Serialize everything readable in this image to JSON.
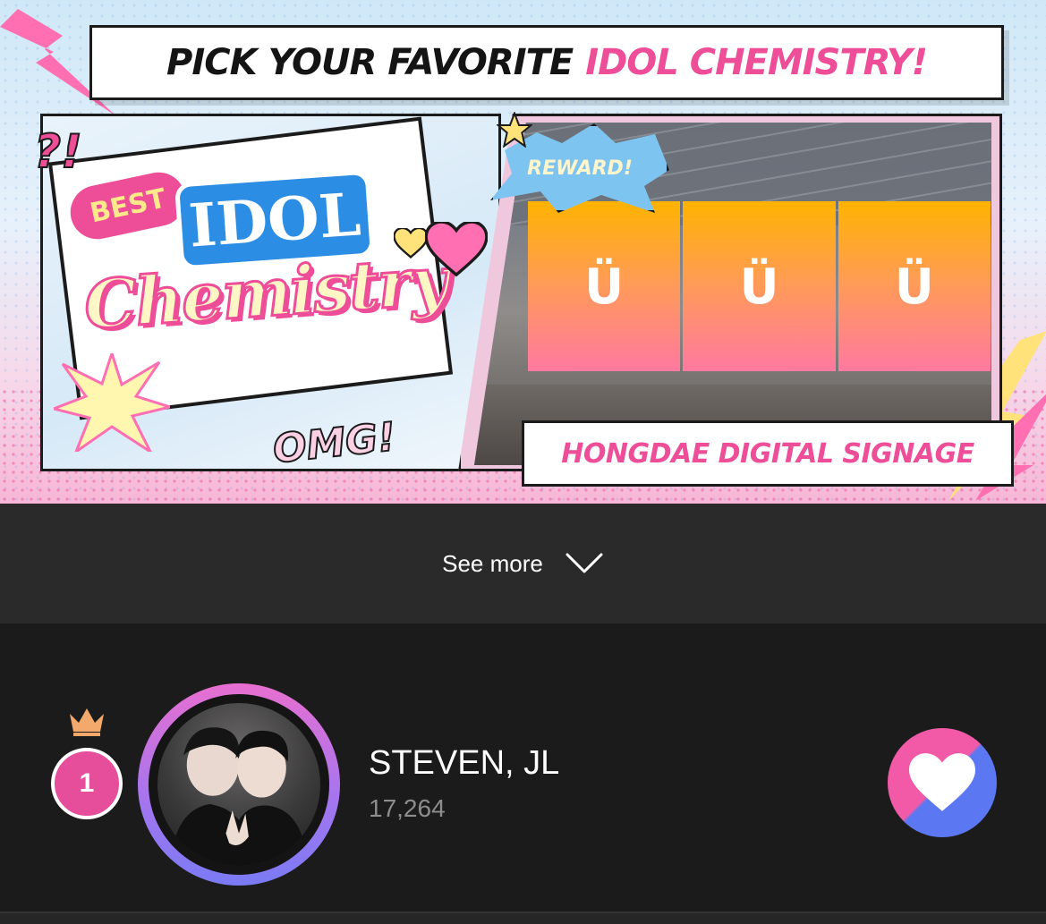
{
  "banner": {
    "headline_part1": "PICK YOUR FAVORITE",
    "headline_part2": "IDOL CHEMISTRY!",
    "logo_best": "BEST",
    "logo_idol": "IDOL",
    "logo_chemistry": "Chemistry",
    "sticker_question": "?!",
    "sticker_omg": "OMG!",
    "sticker_reward": "REWARD!",
    "signage_logo": "Ü",
    "location_caption": "HONGDAE DIGITAL SIGNAGE"
  },
  "see_more": {
    "label": "See more",
    "icon": "chevron-down-icon"
  },
  "ranking": {
    "items": [
      {
        "rank": "1",
        "name": "STEVEN, JL",
        "votes": "17,264",
        "rank_icon": "crown-icon",
        "vote_icon": "heart-icon"
      }
    ]
  },
  "colors": {
    "accent_pink": "#ee4d98",
    "accent_blue": "#5b78f2",
    "background": "#1b1b1b",
    "see_more_bg": "#2a2a2a",
    "crown": "#f3a96b"
  }
}
